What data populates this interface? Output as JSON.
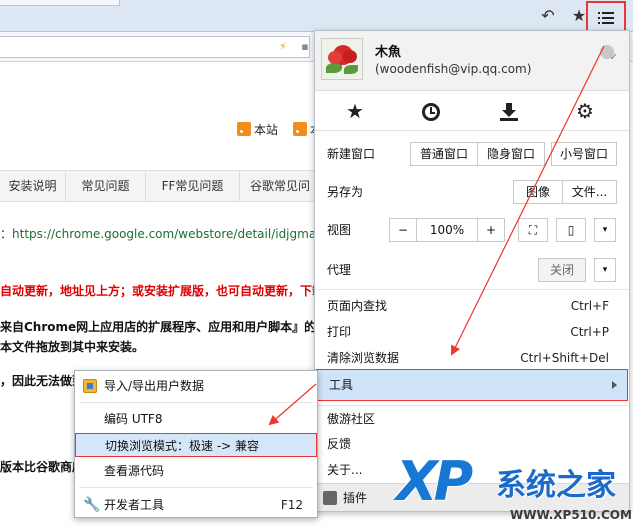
{
  "browser": {
    "toolbar_icons": [
      "undo-icon",
      "star-icon",
      "menu-icon"
    ],
    "address_icons": [
      "lightning-icon",
      "lock-icon"
    ]
  },
  "page": {
    "rss_links": [
      "本站",
      "本"
    ],
    "nav": [
      "安装说明",
      "常见问题",
      "FF常见问题",
      "谷歌常见问"
    ],
    "url_line_prefix": "：",
    "url_text": "https://chrome.google.com/webstore/detail/idjgma",
    "red_line": "自动更新，地址见上方；或安装扩展版，也可自动更新，下载",
    "bold_line": "来自Chrome网上应用店的扩展程序、应用和用户脚本』的勾",
    "drag_line": "本文件拖放到其中来安装。",
    "plain_line": "，因此无法做到",
    "version_line": "版本比谷歌商店"
  },
  "menu": {
    "profile": {
      "name": "木魚",
      "email": "(woodenfish@vip.qq.com)"
    },
    "quick_icons": [
      "bookmark-star-icon",
      "history-icon",
      "download-icon",
      "settings-gear-icon"
    ],
    "new_window": {
      "label": "新建窗口",
      "buttons": [
        "普通窗口",
        "隐身窗口",
        "小号窗口"
      ]
    },
    "save_as": {
      "label": "另存为",
      "buttons": [
        "图像",
        "文件..."
      ]
    },
    "zoom": {
      "label": "视图",
      "minus": "−",
      "value": "100%",
      "plus": "+"
    },
    "proxy": {
      "label": "代理",
      "toggle": "关闭"
    },
    "items": [
      {
        "label": "页面内查找",
        "shortcut": "Ctrl+F"
      },
      {
        "label": "打印",
        "shortcut": "Ctrl+P"
      },
      {
        "label": "清除浏览数据",
        "shortcut": "Ctrl+Shift+Del"
      }
    ],
    "tools": "工具",
    "community": "傲游社区",
    "feedback": "反馈",
    "about": "关于...",
    "plugins": "插件"
  },
  "submenu": {
    "import": "导入/导出用户数据",
    "encoding": "编码 UTF8",
    "switch_mode": "切换浏览模式：极速 -> 兼容",
    "view_source": "查看源代码",
    "devtools": "开发者工具",
    "devtools_shortcut": "F12"
  },
  "watermark": {
    "logo": "XP",
    "title": "系统之家",
    "url": "WWW.XP510.COM"
  },
  "colors": {
    "highlight": "#cfe4f8",
    "annotation_red": "#e33333",
    "watermark_blue": "#1877d2"
  }
}
